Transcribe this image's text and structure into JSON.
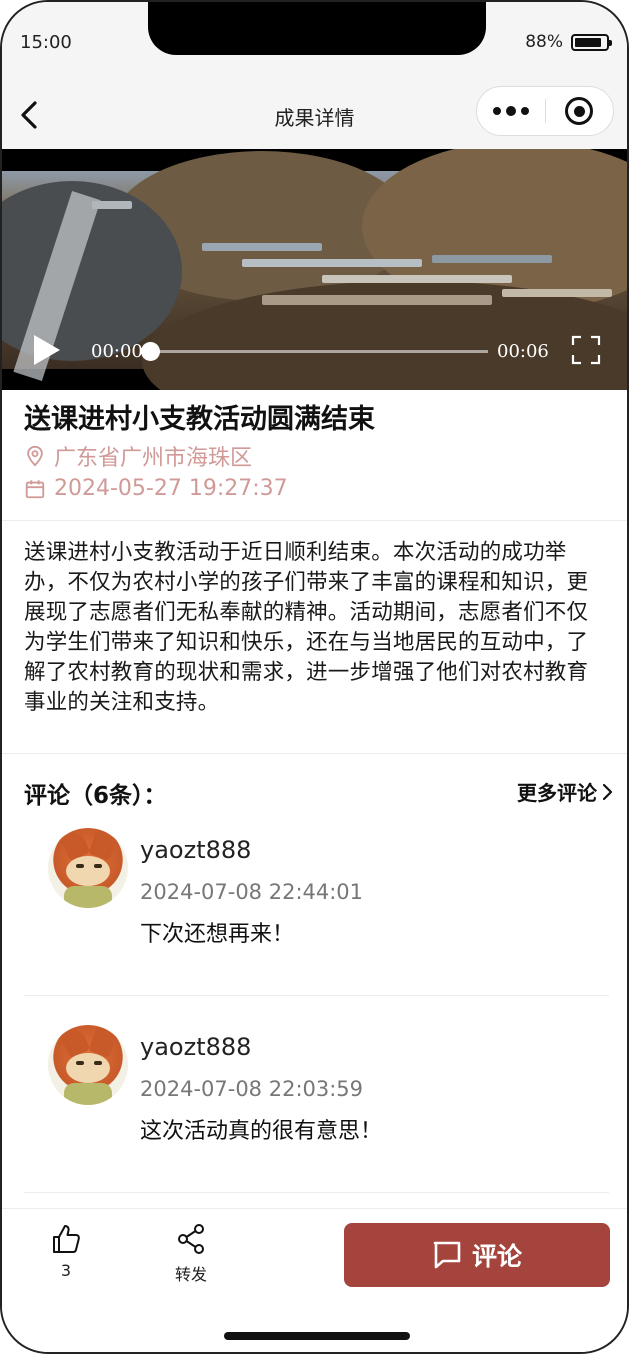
{
  "status_bar": {
    "time": "15:00",
    "battery": "88%",
    "battery_level": 0.88
  },
  "nav": {
    "title": "成果详情"
  },
  "video": {
    "current_time": "00:00",
    "duration": "00:06",
    "progress": 0
  },
  "article": {
    "title": "送课进村小支教活动圆满结束",
    "location": "广东省广州市海珠区",
    "datetime": "2024-05-27 19:27:37",
    "body": "送课进村小支教活动于近日顺利结束。本次活动的成功举办，不仅为农村小学的孩子们带来了丰富的课程和知识，更展现了志愿者们无私奉献的精神。活动期间，志愿者们不仅为学生们带来了知识和快乐，还在与当地居民的互动中，了解了农村教育的现状和需求，进一步增强了他们对农村教育事业的关注和支持。"
  },
  "comments": {
    "header": "评论（6条）：",
    "more_label": "更多评论",
    "items": [
      {
        "user": "yaozt888",
        "time": "2024-07-08 22:44:01",
        "text": "下次还想再来！"
      },
      {
        "user": "yaozt888",
        "time": "2024-07-08 22:03:59",
        "text": "这次活动真的很有意思！"
      }
    ]
  },
  "bottom_bar": {
    "like_count": "3",
    "share_label": "转发",
    "comment_label": "评论",
    "comment_button_color": "#a4443c"
  },
  "colors": {
    "meta_text": "#d09a98",
    "accent": "#a4443c"
  }
}
